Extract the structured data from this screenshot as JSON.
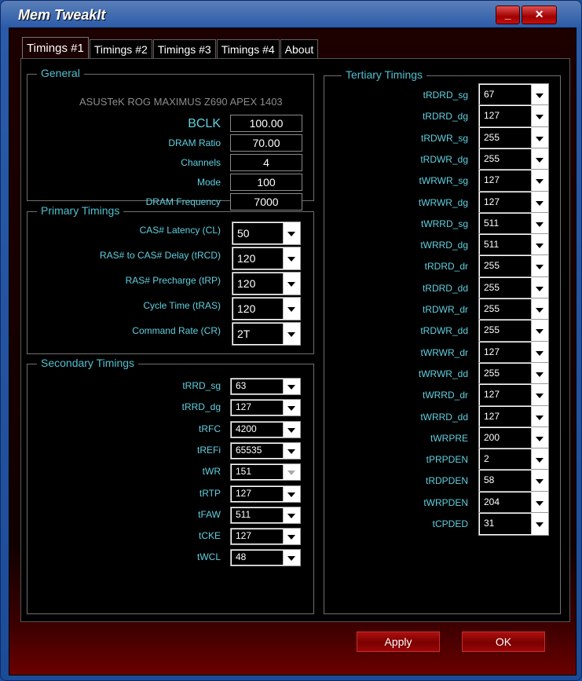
{
  "window": {
    "title": "Mem TweakIt",
    "min_label": "_",
    "close_label": "✕"
  },
  "tabs": [
    "Timings #1",
    "Timings #2",
    "Timings #3",
    "Timings #4",
    "About"
  ],
  "general": {
    "title": "General",
    "system_name": "ASUSTeK ROG MAXIMUS Z690 APEX 1403",
    "fields": [
      {
        "label": "BCLK",
        "value": "100.00"
      },
      {
        "label": "DRAM Ratio",
        "value": "70.00"
      },
      {
        "label": "Channels",
        "value": "4"
      },
      {
        "label": "Mode",
        "value": "100"
      },
      {
        "label": "DRAM Frequency",
        "value": "7000"
      }
    ]
  },
  "primary": {
    "title": "Primary Timings",
    "fields": [
      {
        "label": "CAS# Latency (CL)",
        "value": "50"
      },
      {
        "label": "RAS# to CAS# Delay (tRCD)",
        "value": "120"
      },
      {
        "label": "RAS# Precharge (tRP)",
        "value": "120"
      },
      {
        "label": "Cycle Time (tRAS)",
        "value": "120"
      },
      {
        "label": "Command Rate (CR)",
        "value": "2T"
      }
    ]
  },
  "secondary": {
    "title": "Secondary Timings",
    "fields": [
      {
        "label": "tRRD_sg",
        "value": "63"
      },
      {
        "label": "tRRD_dg",
        "value": "127"
      },
      {
        "label": "tRFC",
        "value": "4200"
      },
      {
        "label": "tREFi",
        "value": "65535"
      },
      {
        "label": "tWR",
        "value": "151"
      },
      {
        "label": "tRTP",
        "value": "127"
      },
      {
        "label": "tFAW",
        "value": "511"
      },
      {
        "label": "tCKE",
        "value": "127"
      },
      {
        "label": "tWCL",
        "value": "48"
      }
    ]
  },
  "tertiary": {
    "title": "Tertiary Timings",
    "fields": [
      {
        "label": "tRDRD_sg",
        "value": "67"
      },
      {
        "label": "tRDRD_dg",
        "value": "127"
      },
      {
        "label": "tRDWR_sg",
        "value": "255"
      },
      {
        "label": "tRDWR_dg",
        "value": "255"
      },
      {
        "label": "tWRWR_sg",
        "value": "127"
      },
      {
        "label": "tWRWR_dg",
        "value": "127"
      },
      {
        "label": "tWRRD_sg",
        "value": "511"
      },
      {
        "label": "tWRRD_dg",
        "value": "511"
      },
      {
        "label": "tRDRD_dr",
        "value": "255"
      },
      {
        "label": "tRDRD_dd",
        "value": "255"
      },
      {
        "label": "tRDWR_dr",
        "value": "255"
      },
      {
        "label": "tRDWR_dd",
        "value": "255"
      },
      {
        "label": "tWRWR_dr",
        "value": "127"
      },
      {
        "label": "tWRWR_dd",
        "value": "255"
      },
      {
        "label": "tWRRD_dr",
        "value": "127"
      },
      {
        "label": "tWRRD_dd",
        "value": "127"
      },
      {
        "label": "tWRPRE",
        "value": "200"
      },
      {
        "label": "tPRPDEN",
        "value": "2"
      },
      {
        "label": "tRDPDEN",
        "value": "58"
      },
      {
        "label": "tWRPDEN",
        "value": "204"
      },
      {
        "label": "tCPDED",
        "value": "31"
      }
    ]
  },
  "buttons": {
    "apply": "Apply",
    "ok": "OK"
  }
}
